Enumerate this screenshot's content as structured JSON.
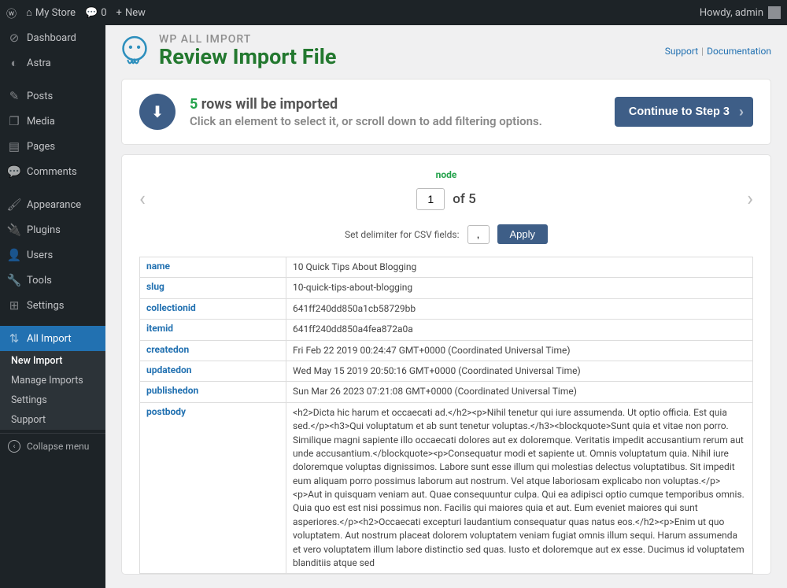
{
  "adminbar": {
    "site": "My Store",
    "comments": "0",
    "new": "New",
    "greeting": "Howdy, admin"
  },
  "sidebar": {
    "items": [
      {
        "icon": "⊘",
        "label": "Dashboard"
      },
      {
        "icon": "◐",
        "label": "Astra"
      }
    ],
    "items2": [
      {
        "icon": "✎",
        "label": "Posts"
      },
      {
        "icon": "❐",
        "label": "Media"
      },
      {
        "icon": "▤",
        "label": "Pages"
      },
      {
        "icon": "💬",
        "label": "Comments"
      }
    ],
    "items3": [
      {
        "icon": "🖌",
        "label": "Appearance"
      },
      {
        "icon": "🔌",
        "label": "Plugins"
      },
      {
        "icon": "👤",
        "label": "Users"
      },
      {
        "icon": "🔧",
        "label": "Tools"
      },
      {
        "icon": "⊞",
        "label": "Settings"
      }
    ],
    "active": {
      "icon": "⇅",
      "label": "All Import"
    },
    "subs": [
      {
        "label": "New Import",
        "sel": true
      },
      {
        "label": "Manage Imports"
      },
      {
        "label": "Settings"
      },
      {
        "label": "Support"
      }
    ],
    "collapse": "Collapse menu"
  },
  "header": {
    "pre": "WP ALL IMPORT",
    "title": "Review Import File",
    "support": "Support",
    "docs": "Documentation"
  },
  "intro": {
    "count": "5",
    "line1_rest": " rows will be imported",
    "line2": "Click an element to select it, or scroll down to add filtering options.",
    "cta": "Continue to Step 3"
  },
  "preview": {
    "nodelabel": "node",
    "page_current": "1",
    "page_of": "of 5",
    "delim_label": "Set delimiter for CSV fields:",
    "delim_value": ",",
    "apply": "Apply",
    "fields": [
      {
        "k": "name",
        "v": "10 Quick Tips About Blogging"
      },
      {
        "k": "slug",
        "v": "10-quick-tips-about-blogging"
      },
      {
        "k": "collectionid",
        "v": "641ff240dd850a1cb58729bb"
      },
      {
        "k": "itemid",
        "v": "641ff240dd850a4fea872a0a"
      },
      {
        "k": "createdon",
        "v": "Fri Feb 22 2019 00:24:47 GMT+0000 (Coordinated Universal Time)"
      },
      {
        "k": "updatedon",
        "v": "Wed May 15 2019 20:50:16 GMT+0000 (Coordinated Universal Time)"
      },
      {
        "k": "publishedon",
        "v": "Sun Mar 26 2023 07:21:08 GMT+0000 (Coordinated Universal Time)"
      },
      {
        "k": "postbody",
        "v": "<h2>Dicta hic harum et occaecati ad.</h2><p>Nihil tenetur qui iure assumenda. Ut optio officia. Est quia sed.</p><h3>Qui voluptatum et ab sunt tenetur voluptas.</h3><blockquote>Sunt quia et vitae non porro. Similique magni sapiente illo occaecati dolores aut ex doloremque. Veritatis impedit accusantium rerum aut unde accusantium.</blockquote><p>Consequatur modi et sapiente ut. Omnis voluptatum quia. Nihil iure doloremque voluptas dignissimos. Labore sunt esse illum qui molestias delectus voluptatibus. Sit impedit eum aliquam porro possimus laborum aut nostrum. Vel atque laboriosam explicabo non voluptas.</p><p>Aut in quisquam veniam aut. Quae consequuntur culpa. Qui ea adipisci optio cumque temporibus omnis. Quia quo est est nisi possimus non. Facilis qui maiores quia et aut. Eum eveniet maiores qui sunt asperiores.</p><h2>Occaecati excepturi laudantium consequatur quas natus eos.</h2><p>Enim ut quo voluptatem. Aut nostrum placeat dolorem voluptatem veniam fugiat omnis illum sequi. Harum assumenda et vero voluptatem illum labore distinctio sed quas. Iusto et doloremque aut ex esse. Ducimus id voluptatem blanditiis atque sed"
      }
    ]
  }
}
